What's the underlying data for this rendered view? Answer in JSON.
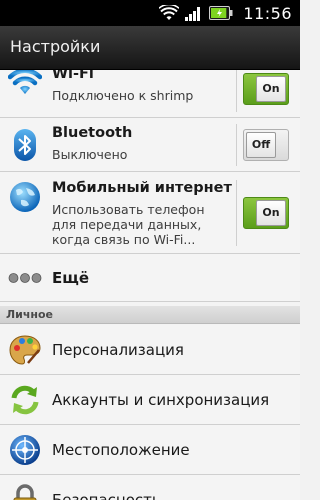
{
  "status_bar": {
    "time": "11:56",
    "icons": [
      "wifi-icon",
      "signal-icon",
      "battery-icon"
    ],
    "battery_level": 0.9
  },
  "header": {
    "title": "Настройки"
  },
  "settings": {
    "wifi": {
      "label": "Wi-Fi",
      "subtitle": "Подключено к shrimp",
      "toggle": "On",
      "icon": "wifi-icon"
    },
    "bluetooth": {
      "label": "Bluetooth",
      "subtitle": "Выключено",
      "toggle": "Off",
      "icon": "bluetooth-icon"
    },
    "mobile": {
      "label": "Мобильный интернет",
      "subtitle_lines": [
        "Использовать телефон",
        "для передачи данных,",
        "когда связь по Wi-Fi..."
      ],
      "toggle": "On",
      "icon": "globe-icon"
    },
    "more": {
      "label": "Ещё",
      "icon": "more-icon"
    }
  },
  "section_personal": {
    "label": "Личное"
  },
  "personal": {
    "personalization": {
      "label": "Персонализация",
      "icon": "palette-icon"
    },
    "accounts": {
      "label": "Аккаунты и синхронизация",
      "icon": "sync-icon"
    },
    "location": {
      "label": "Местоположение",
      "icon": "location-icon"
    },
    "security": {
      "label": "Безопасность",
      "icon": "lock-icon"
    }
  },
  "colors": {
    "toggle_on": "#6fb22b",
    "status_bar": "#000000",
    "title_bar": "#1f1f1f"
  }
}
